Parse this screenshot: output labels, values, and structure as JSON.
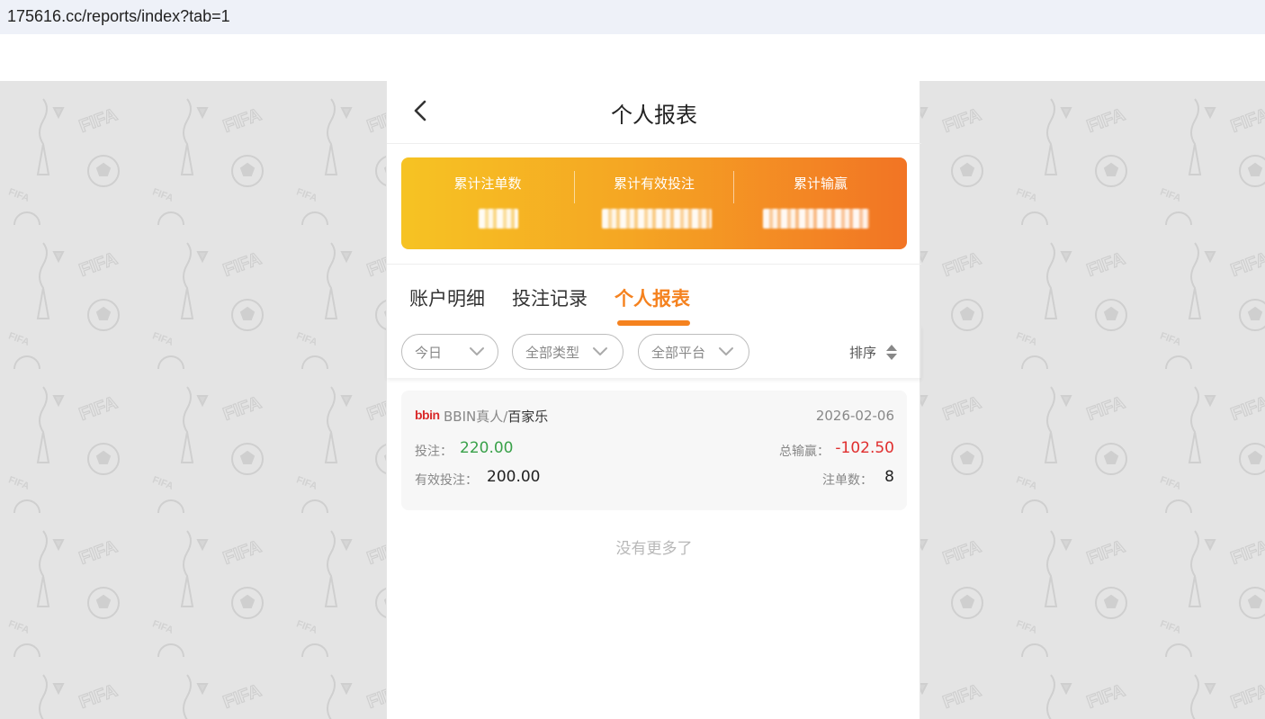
{
  "browser": {
    "url": "175616.cc/reports/index?tab=1"
  },
  "header": {
    "title": "个人报表",
    "back_icon": "chevron-left-icon"
  },
  "summary": {
    "items": [
      {
        "label": "累计注单数"
      },
      {
        "label": "累计有效投注"
      },
      {
        "label": "累计输赢"
      }
    ],
    "gradient": [
      "#f6c323",
      "#f27424"
    ]
  },
  "tabs": [
    {
      "label": "账户明细",
      "active": false
    },
    {
      "label": "投注记录",
      "active": false
    },
    {
      "label": "个人报表",
      "active": true
    }
  ],
  "filters": {
    "date": "今日",
    "type": "全部类型",
    "platform": "全部平台",
    "sort_label": "排序"
  },
  "record": {
    "logo": "bbin",
    "provider": "BBIN真人",
    "separator": "/",
    "game": "百家乐",
    "date": "2026-02-06",
    "bet_label": "投注：",
    "bet_value": "220.00",
    "win_label": "总输赢：",
    "win_value": "-102.50",
    "valid_label": "有效投注：",
    "valid_value": "200.00",
    "count_label": "注单数：",
    "count_value": "8"
  },
  "footer": {
    "no_more": "没有更多了"
  },
  "colors": {
    "accent": "#f5821f",
    "positive": "#3aa14a",
    "negative": "#e02e2e"
  }
}
